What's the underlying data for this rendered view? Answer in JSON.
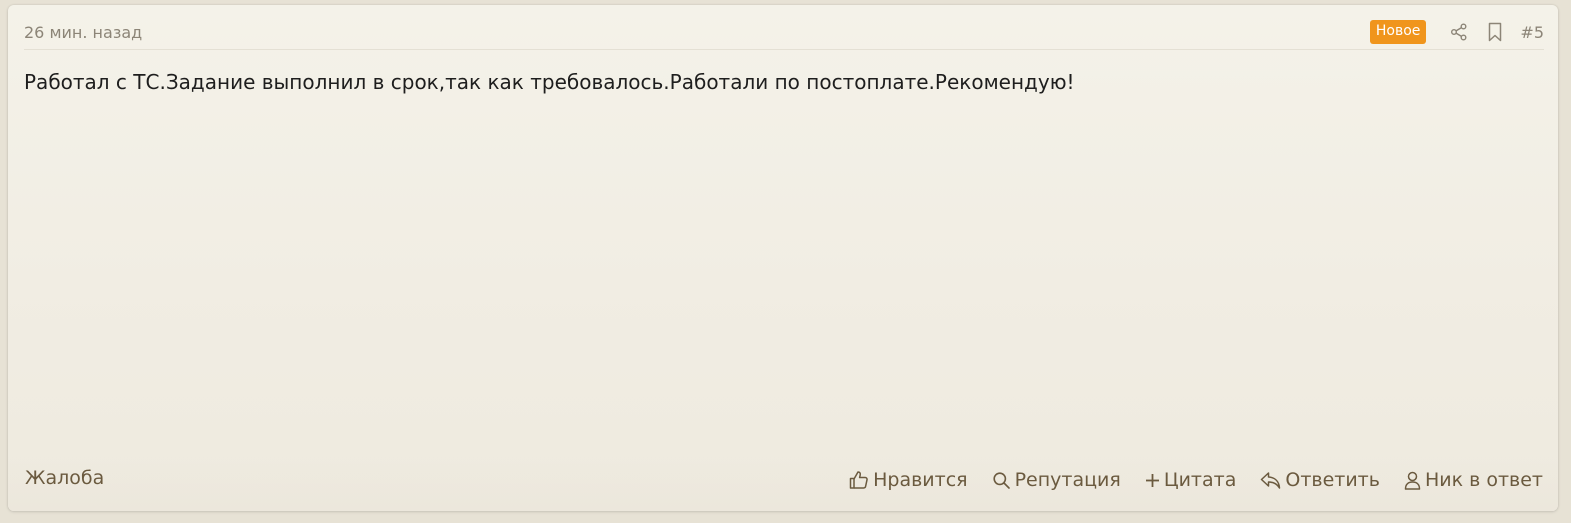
{
  "post": {
    "timestamp": "26 мин. назад",
    "badge": "Новое",
    "number": "#5",
    "body": "Работал с ТС.Задание выполнил в срок,так как требовалось.Работали по постоплате.Рекомендую!"
  },
  "header_icons": [
    "share-icon",
    "bookmark-icon"
  ],
  "footer": {
    "report_label": "Жалоба",
    "actions": [
      {
        "label": "Нравится",
        "icon": "thumbs-up-icon"
      },
      {
        "label": "Репутация",
        "icon": "search-icon"
      },
      {
        "label": "Цитата",
        "icon": "plus-icon"
      },
      {
        "label": "Ответить",
        "icon": "reply-icon"
      },
      {
        "label": "Ник в ответ",
        "icon": "user-icon"
      }
    ]
  },
  "colors": {
    "badge": "#f0951c",
    "action_text": "#6b5a3f",
    "meta_text": "#8c8577",
    "body_text": "#1e1e1e"
  }
}
